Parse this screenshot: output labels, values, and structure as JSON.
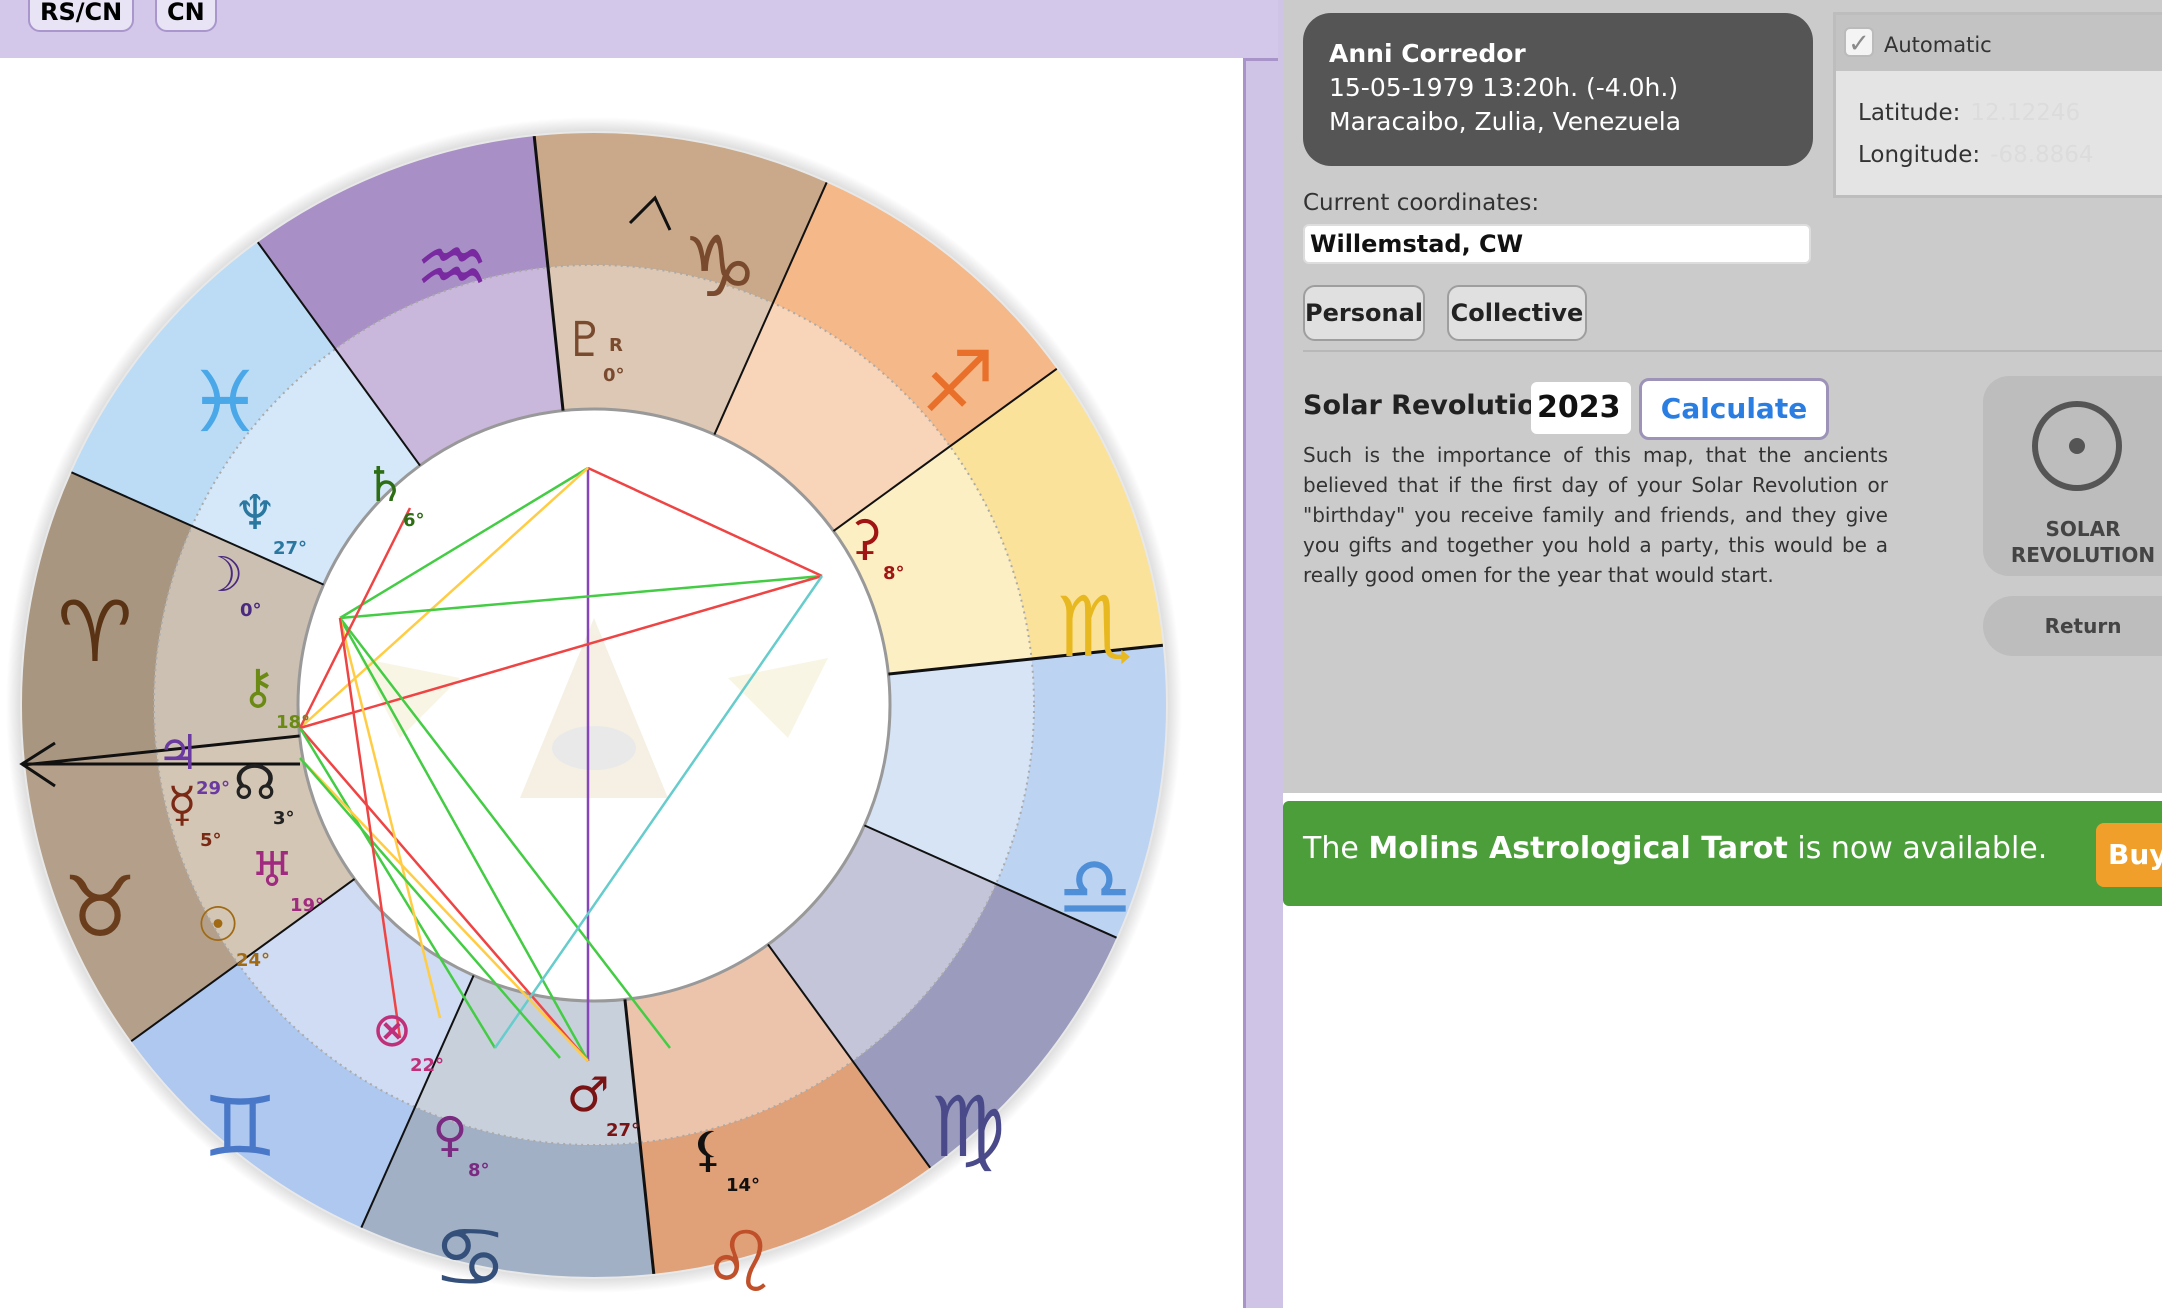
{
  "topbar": {
    "buttons": [
      "RS/CN",
      "CN"
    ]
  },
  "profile": {
    "name": "Anni Corredor",
    "datetime": "15-05-1979 13:20h. (-4.0h.)",
    "place": "Maracaibo, Zulia, Venezuela"
  },
  "coords": {
    "auto_label": "Automatic",
    "latitude_label": "Latitude:",
    "latitude_value": "12.12246",
    "longitude_label": "Longitude:",
    "longitude_value": "-68.8864"
  },
  "current": {
    "label": "Current coordinates:",
    "value": "Willemstad, CW"
  },
  "filters": {
    "personal": "Personal",
    "collective": "Collective"
  },
  "solar": {
    "label": "Solar Revolution",
    "year": "2023",
    "calculate": "Calculate",
    "description": "Such is the importance of this map, that the ancients believed that if the first day of your Solar Revolution or \"birthday\" you receive family and friends, and they give you gifts and together you hold a party, this would be a really good omen for the year that would start.",
    "tile_line1": "SOLAR",
    "tile_line2": "REVOLUTION",
    "return": "Return"
  },
  "banner": {
    "pre": "The ",
    "bold": "Molins Astrological Tarot",
    "post": " is now available.",
    "buy": "Buy"
  },
  "chart": {
    "signs": [
      {
        "glyph": "♑",
        "color": "#7a4a2e"
      },
      {
        "glyph": "♐",
        "color": "#e8702a"
      },
      {
        "glyph": "♏",
        "color": "#e8b820"
      },
      {
        "glyph": "♎",
        "color": "#4e8fd8"
      },
      {
        "glyph": "♍",
        "color": "#4a4a8a"
      },
      {
        "glyph": "♌",
        "color": "#c0502a"
      },
      {
        "glyph": "♋",
        "color": "#34507a"
      },
      {
        "glyph": "♊",
        "color": "#4a78c8"
      },
      {
        "glyph": "♉",
        "color": "#6a3e1c"
      },
      {
        "glyph": "♈",
        "color": "#5a3214"
      },
      {
        "glyph": "♓",
        "color": "#4aa8e8"
      },
      {
        "glyph": "♒",
        "color": "#7a2aa0"
      }
    ],
    "planets": [
      {
        "glyph": "♇",
        "deg": "0°",
        "retro": "R",
        "color": "#7a4a2e"
      },
      {
        "glyph": "♄",
        "deg": "6°",
        "color": "#2d6e14"
      },
      {
        "glyph": "♆",
        "deg": "27°",
        "color": "#2a78a0"
      },
      {
        "glyph": "☽",
        "deg": "0°",
        "color": "#4a2a80"
      },
      {
        "glyph": "⚷",
        "deg": "18°",
        "color": "#6a8a14"
      },
      {
        "glyph": "♃",
        "deg": "29°",
        "color": "#6a3aa0"
      },
      {
        "glyph": "☊",
        "deg": "3°",
        "color": "#222222"
      },
      {
        "glyph": "☿",
        "deg": "5°",
        "color": "#7a2a14"
      },
      {
        "glyph": "♅",
        "deg": "19°",
        "color": "#a02a80"
      },
      {
        "glyph": "☉",
        "deg": "24°",
        "color": "#a06a14"
      },
      {
        "glyph": "⊗",
        "deg": "22°",
        "color": "#c0307a"
      },
      {
        "glyph": "♀",
        "deg": "8°",
        "color": "#7a2a80"
      },
      {
        "glyph": "♂",
        "deg": "27°",
        "color": "#7a1414"
      },
      {
        "glyph": "⚸",
        "deg": "14°",
        "color": "#111111"
      },
      {
        "glyph": "⚳",
        "deg": "8°",
        "color": "#a01414"
      }
    ]
  }
}
